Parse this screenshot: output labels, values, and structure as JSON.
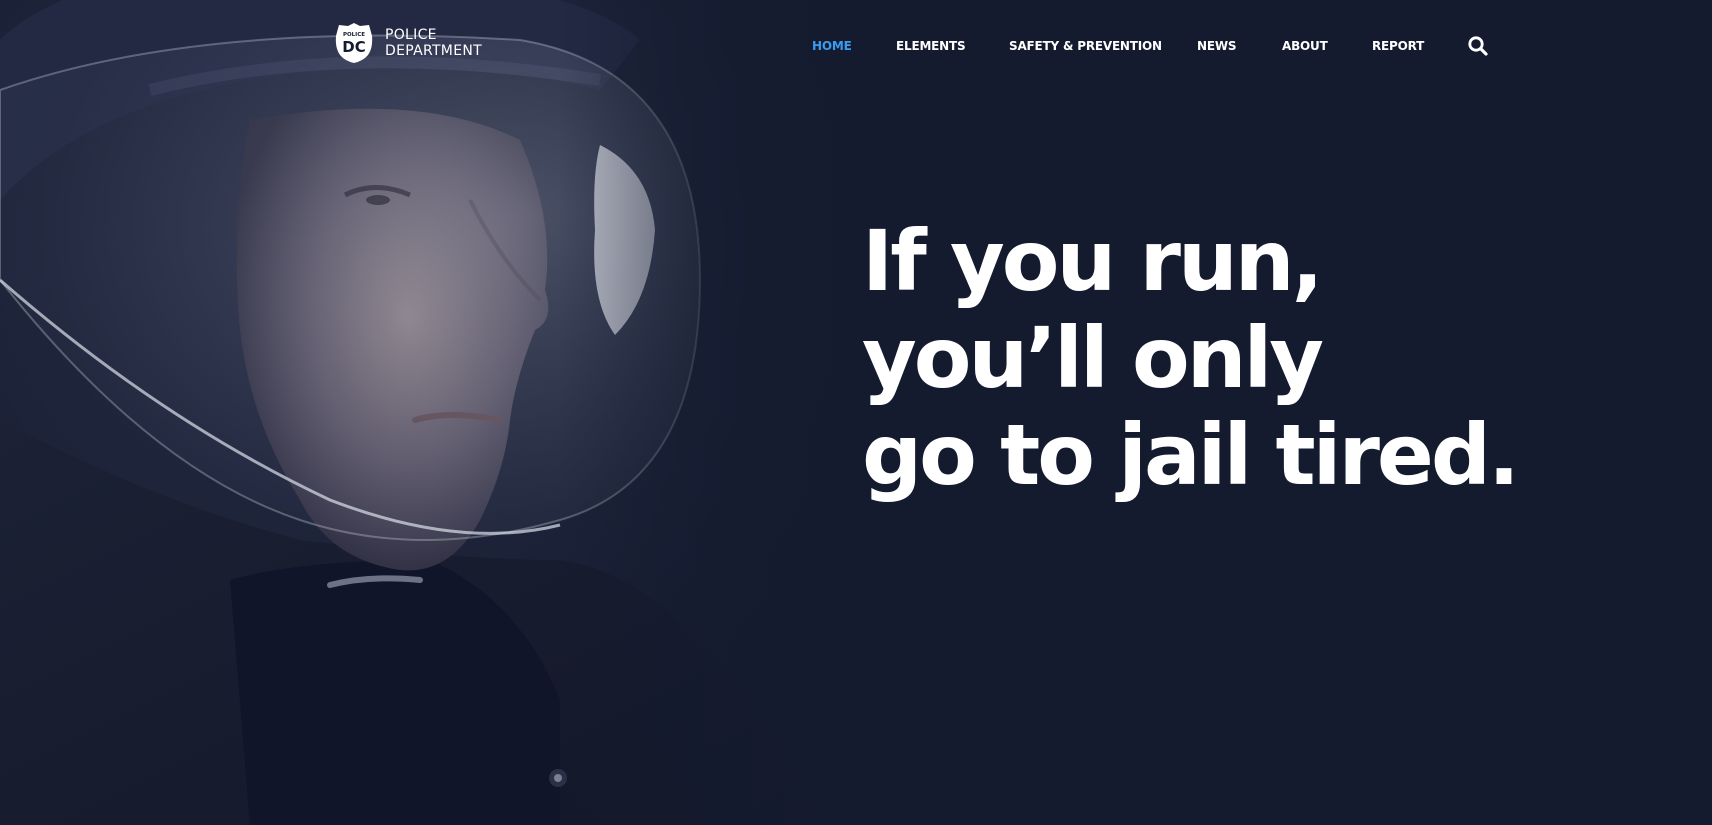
{
  "logo": {
    "badge_small": "POLICE",
    "badge_big": "DC",
    "line1": "POLICE",
    "line2": "DEPARTMENT"
  },
  "nav": {
    "items": [
      {
        "label": "HOME",
        "active": true
      },
      {
        "label": "ELEMENTS",
        "active": false
      },
      {
        "label": "SAFETY & PREVENTION",
        "active": false
      },
      {
        "label": "NEWS",
        "active": false
      },
      {
        "label": "ABOUT",
        "active": false
      },
      {
        "label": "REPORT",
        "active": false
      }
    ],
    "search_icon": "search-icon"
  },
  "hero": {
    "headline_lines": [
      "If you run,",
      "you’ll only",
      "go to jail tired."
    ],
    "image_subject": "police officer in riot helmet"
  },
  "colors": {
    "background": "#151b2f",
    "accent": "#3a9cf0",
    "text": "#ffffff"
  }
}
